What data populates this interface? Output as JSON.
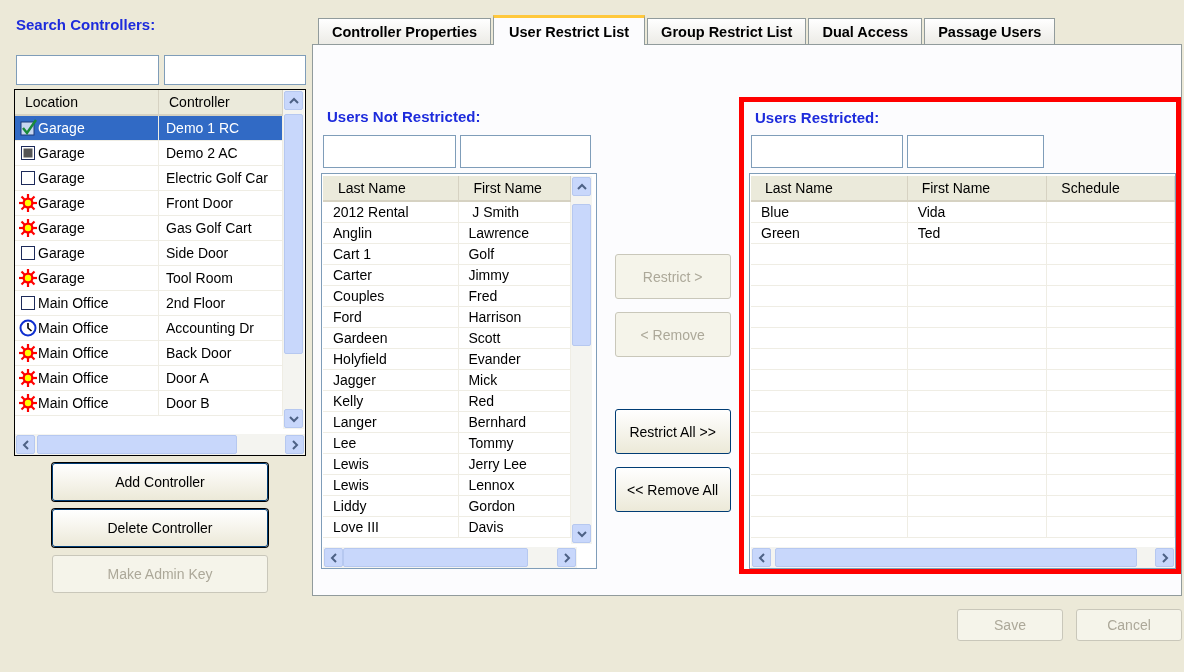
{
  "controllers_panel": {
    "title": "Search Controllers:",
    "columns": [
      "Location",
      "Controller"
    ],
    "rows": [
      {
        "kind": "checked",
        "location": "Garage",
        "controller": "Demo 1 RC",
        "selected": true
      },
      {
        "kind": "stopped",
        "location": "Garage",
        "controller": "Demo 2 AC",
        "selected": false
      },
      {
        "kind": "empty",
        "location": "Garage",
        "controller": "Electric Golf Car",
        "selected": false
      },
      {
        "kind": "alarm",
        "location": "Garage",
        "controller": "Front Door",
        "selected": false
      },
      {
        "kind": "alarm",
        "location": "Garage",
        "controller": "Gas Golf Cart",
        "selected": false
      },
      {
        "kind": "empty",
        "location": "Garage",
        "controller": "Side Door",
        "selected": false
      },
      {
        "kind": "alarm",
        "location": "Garage",
        "controller": "Tool Room",
        "selected": false
      },
      {
        "kind": "empty",
        "location": "Main Office",
        "controller": "2nd Floor",
        "selected": false
      },
      {
        "kind": "clock",
        "location": "Main Office",
        "controller": "Accounting Dr",
        "selected": false
      },
      {
        "kind": "alarm",
        "location": "Main Office",
        "controller": "Back Door",
        "selected": false
      },
      {
        "kind": "alarm",
        "location": "Main Office",
        "controller": "Door A",
        "selected": false
      },
      {
        "kind": "alarm",
        "location": "Main Office",
        "controller": "Door B",
        "selected": false
      }
    ],
    "buttons": [
      {
        "label": "Add Controller",
        "disabled": false
      },
      {
        "label": "Delete Controller",
        "disabled": false
      },
      {
        "label": "Make Admin Key",
        "disabled": true
      }
    ]
  },
  "tabs": [
    {
      "label": "Controller Properties",
      "selected": false
    },
    {
      "label": "User Restrict List",
      "selected": true
    },
    {
      "label": "Group Restrict List",
      "selected": false
    },
    {
      "label": "Dual Access",
      "selected": false
    },
    {
      "label": "Passage Users",
      "selected": false
    }
  ],
  "users_not_restricted": {
    "title": "Users Not Restricted:",
    "columns": [
      "Last Name",
      "First Name"
    ],
    "rows": [
      [
        "2012 Rental",
        " J Smith"
      ],
      [
        "Anglin",
        "Lawrence"
      ],
      [
        "Cart 1",
        "Golf"
      ],
      [
        "Carter",
        "Jimmy"
      ],
      [
        "Couples",
        "Fred"
      ],
      [
        "Ford",
        "Harrison"
      ],
      [
        "Gardeen",
        "Scott"
      ],
      [
        "Holyfield",
        "Evander"
      ],
      [
        "Jagger",
        "Mick"
      ],
      [
        "Kelly",
        "Red"
      ],
      [
        "Langer",
        "Bernhard"
      ],
      [
        "Lee",
        "Tommy"
      ],
      [
        "Lewis",
        "Jerry Lee"
      ],
      [
        "Lewis",
        "Lennox"
      ],
      [
        "Liddy",
        "Gordon"
      ],
      [
        "Love III",
        "Davis"
      ]
    ]
  },
  "move_buttons": [
    {
      "label": "Restrict >",
      "disabled": true
    },
    {
      "label": "< Remove",
      "disabled": true
    },
    {
      "label": "Restrict All >>",
      "disabled": false
    },
    {
      "label": "<< Remove All",
      "disabled": false
    }
  ],
  "users_restricted": {
    "title": "Users Restricted:",
    "highlighted": true,
    "columns": [
      "Last Name",
      "First Name",
      "Schedule"
    ],
    "rows": [
      [
        "Blue",
        "Vida",
        ""
      ],
      [
        "Green",
        "Ted",
        ""
      ]
    ]
  },
  "footer_buttons": [
    {
      "label": "Save",
      "disabled": true
    },
    {
      "label": "Cancel",
      "disabled": true
    }
  ]
}
